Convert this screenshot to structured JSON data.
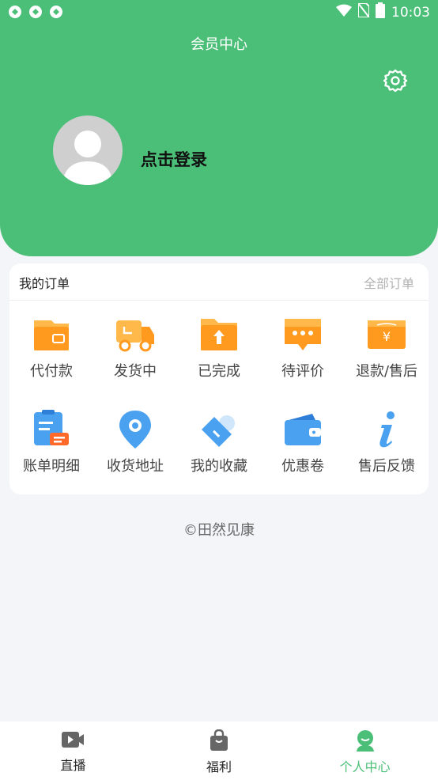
{
  "status_bar": {
    "time": "10:03"
  },
  "header": {
    "title": "会员中心",
    "login_text": "点击登录"
  },
  "orders": {
    "title": "我的订单",
    "all_link": "全部订单",
    "row1": [
      {
        "label": "代付款",
        "icon": "wallet-icon"
      },
      {
        "label": "发货中",
        "icon": "truck-icon"
      },
      {
        "label": "已完成",
        "icon": "folder-upload-icon"
      },
      {
        "label": "待评价",
        "icon": "comment-icon"
      },
      {
        "label": "退款/售后",
        "icon": "refund-icon"
      }
    ],
    "row2": [
      {
        "label": "账单明细",
        "icon": "bill-icon"
      },
      {
        "label": "收货地址",
        "icon": "location-icon"
      },
      {
        "label": "我的收藏",
        "icon": "heart-tag-icon"
      },
      {
        "label": "优惠卷",
        "icon": "coupon-wallet-icon"
      },
      {
        "label": "售后反馈",
        "icon": "info-icon"
      }
    ]
  },
  "footer": {
    "copyright": "©田然见康"
  },
  "tabbar": [
    {
      "label": "直播",
      "icon": "video-icon"
    },
    {
      "label": "福利",
      "icon": "bag-icon"
    },
    {
      "label": "个人中心",
      "icon": "person-icon",
      "active": true
    }
  ],
  "colors": {
    "brand": "#4bbf78",
    "orange": "#ffa024",
    "blue": "#4aa1f0"
  }
}
